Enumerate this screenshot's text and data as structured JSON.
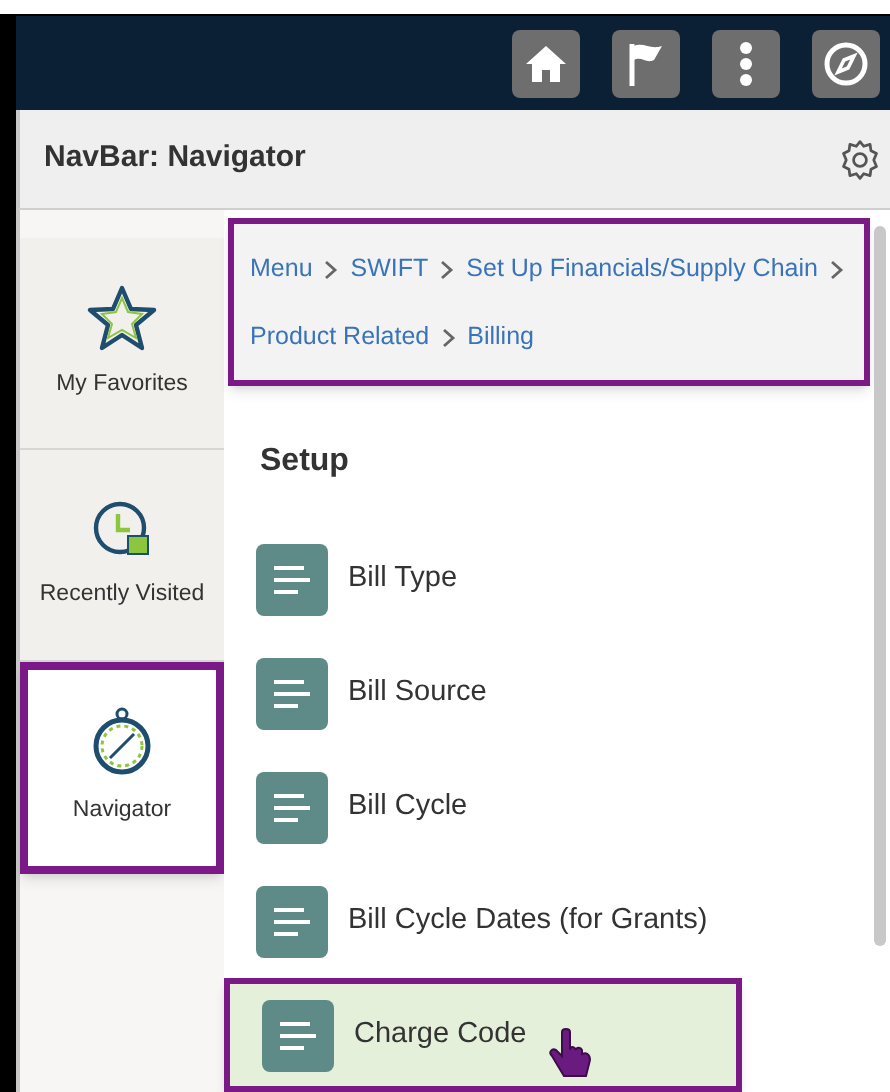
{
  "header": {
    "title": "NavBar: Navigator"
  },
  "sidebar": {
    "items": [
      {
        "label": "My Favorites",
        "kind": "star",
        "selected": false,
        "highlighted": false
      },
      {
        "label": "Recently Visited",
        "kind": "clock",
        "selected": false,
        "highlighted": false
      },
      {
        "label": "Navigator",
        "kind": "compass",
        "selected": true,
        "highlighted": true
      }
    ]
  },
  "breadcrumb": {
    "highlighted": true,
    "items": [
      "Menu",
      "SWIFT",
      "Set Up Financials/Supply Chain",
      "Product Related",
      "Billing"
    ]
  },
  "section": {
    "title": "Setup"
  },
  "menu_items": [
    {
      "label": "Bill Type",
      "selected": false,
      "highlighted": false
    },
    {
      "label": "Bill Source",
      "selected": false,
      "highlighted": false
    },
    {
      "label": "Bill Cycle",
      "selected": false,
      "highlighted": false
    },
    {
      "label": "Bill Cycle Dates (for Grants)",
      "selected": false,
      "highlighted": false
    },
    {
      "label": "Charge Code",
      "selected": true,
      "highlighted": true
    }
  ]
}
